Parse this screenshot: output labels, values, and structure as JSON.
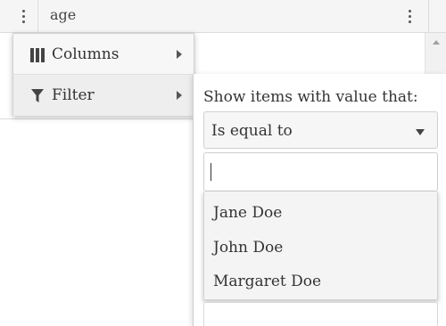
{
  "grid": {
    "header": {
      "column_label": "age",
      "icons": [
        "column-menu-kebab-icon",
        "column-options-kebab-icon"
      ]
    }
  },
  "column_menu": {
    "items": [
      {
        "label": "Columns",
        "icon": "columns-icon",
        "has_submenu": true
      },
      {
        "label": "Filter",
        "icon": "filter-funnel-icon",
        "has_submenu": true
      }
    ]
  },
  "filter_panel": {
    "heading": "Show items with value that:",
    "operator": {
      "selected": "Is equal to"
    },
    "value_input": {
      "value": "",
      "placeholder": ""
    },
    "suggestions": [
      "Jane Doe",
      "John Doe",
      "Margaret Doe"
    ]
  },
  "colors": {
    "header_bg": "#f5f5f5",
    "menu_bg": "#f7f7f7",
    "border": "#d0d0d0",
    "text": "#333333"
  }
}
